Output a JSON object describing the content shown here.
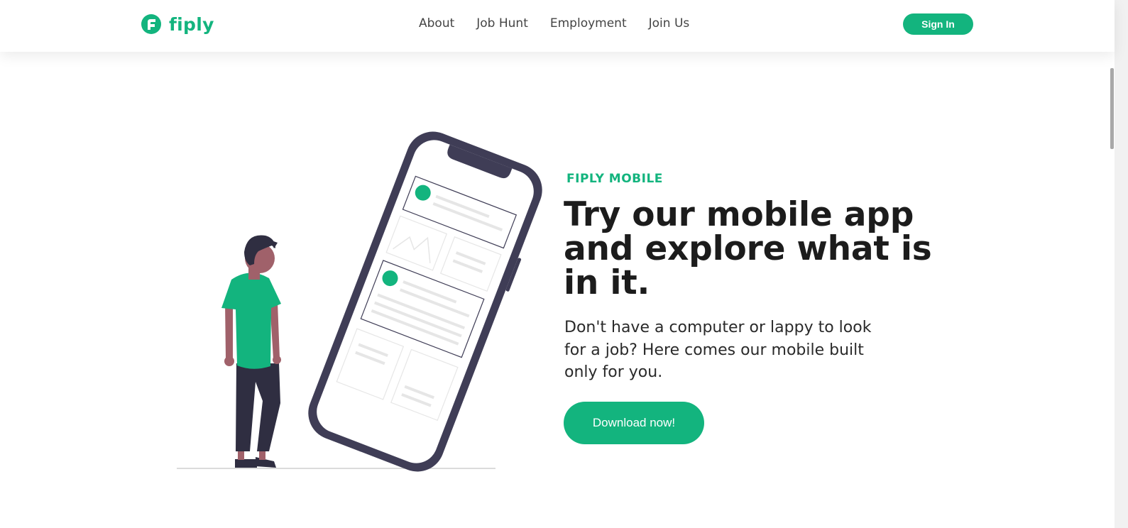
{
  "brand": {
    "name": "fiply",
    "color": "#13b47e"
  },
  "nav": {
    "items": [
      {
        "label": "About"
      },
      {
        "label": "Job Hunt"
      },
      {
        "label": "Employment"
      },
      {
        "label": "Join Us"
      }
    ],
    "signin_label": "Sign In"
  },
  "hero": {
    "eyebrow": "FIPLY MOBILE",
    "headline": "Try our mobile app and explore what is in it.",
    "subtext": "Don't have a computer or lappy to look for a job? Here comes our mobile built only for you.",
    "cta_label": "Download now!"
  },
  "colors": {
    "accent": "#13b47e",
    "phone_frame": "#3f3d56",
    "skin": "#a0616a",
    "pants": "#2f2e41"
  },
  "icons": {
    "logo": "fiply-logo-icon"
  }
}
